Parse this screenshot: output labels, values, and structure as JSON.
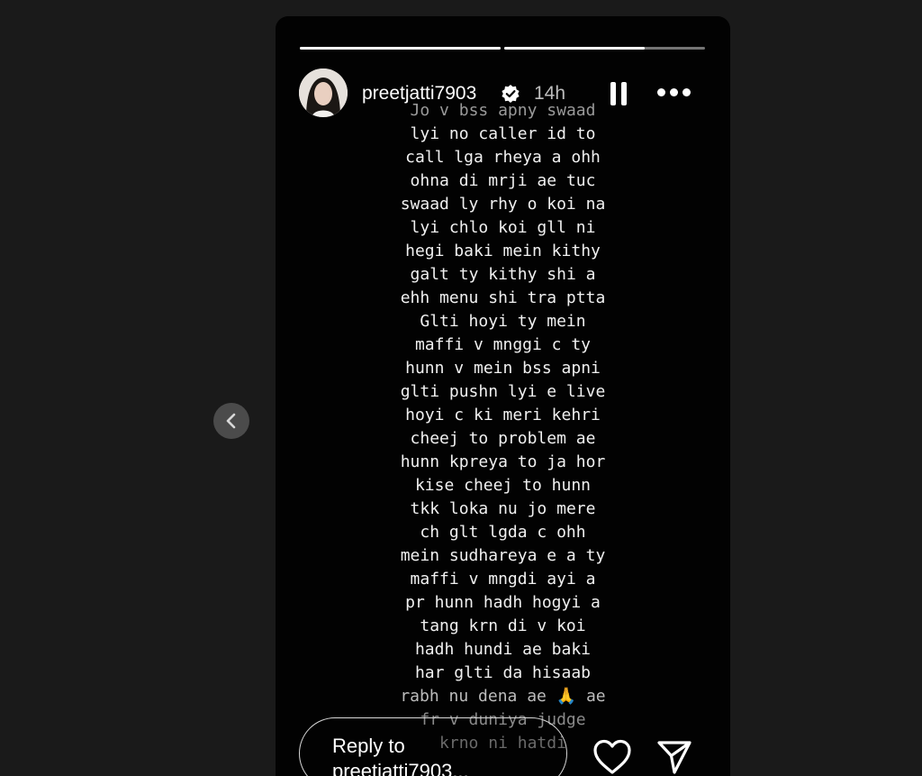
{
  "story": {
    "segments": [
      {
        "progress": 1.0
      },
      {
        "progress": 0.7
      }
    ],
    "username": "preetjatti7903",
    "time": "14h",
    "caption_lines": [
      "Jo v bss apny swaad",
      "lyi no caller id to",
      "call lga rheya a ohh",
      "ohna di mrji ae tuc",
      "swaad ly rhy o koi na",
      "lyi chlo koi gll ni",
      "hegi baki mein kithy",
      "galt ty kithy shi a",
      "ehh menu shi tra ptta",
      "Glti hoyi ty mein",
      "maffi v mnggi c ty",
      "hunn v mein bss apni",
      "glti pushn lyi e live",
      "hoyi c ki meri kehri",
      "cheej to problem ae",
      "hunn kpreya to ja hor",
      "kise cheej to hunn",
      "tkk loka nu jo mere",
      "ch glt lgda c ohh",
      "mein sudhareya e a ty",
      "maffi v mngdi ayi a",
      "pr hunn hadh hogyi a",
      "tang krn di v koi",
      "hadh hundi ae baki",
      "har glti da hisaab",
      "rabh nu dena ae 🙏 ae",
      "fr v duniya judge",
      "krno ni hatdi"
    ],
    "reply_placeholder": "Reply to preetjatti7903..."
  },
  "icons": {
    "verified": "verified-badge-icon",
    "pause": "pause-icon",
    "more": "more-options-icon",
    "heart": "heart-icon",
    "send": "send-icon",
    "prev": "chevron-left-icon"
  },
  "colors": {
    "page_bg": "#1a1a1a",
    "story_bg": "#020202",
    "text": "#ffffff",
    "prev_button": "#4b4b4b"
  }
}
